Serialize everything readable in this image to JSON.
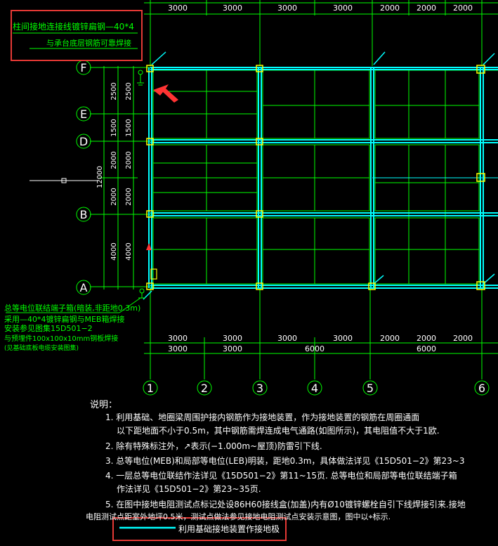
{
  "colors": {
    "background": "#000000",
    "grid": "#00ff00",
    "beam": "#00ffff",
    "column": "#ffff00",
    "text": "#ffffff",
    "highlight": "#e53935"
  },
  "top_dims": [
    "3000",
    "3000",
    "3000",
    "3000",
    "2000",
    "2000",
    "2000"
  ],
  "bottom_dims_row1": [
    "3000",
    "3000",
    "3000",
    "3000",
    "2000",
    "2000",
    "2000"
  ],
  "bottom_dims_row2": [
    "3000",
    "3000",
    "6000",
    "6000"
  ],
  "left_dims_inner": [
    "2500",
    "1500",
    "2000",
    "2000",
    "4000"
  ],
  "left_dims_outer": [
    "2500",
    "1500",
    "2000",
    "2000",
    "4000"
  ],
  "left_total": "12000",
  "row_axes": [
    "F",
    "E",
    "D",
    "B",
    "A"
  ],
  "col_axes": [
    "1",
    "2",
    "3",
    "4",
    "5",
    "6"
  ],
  "callout_top": {
    "line1": "柱间接地连接线镀锌扁钢—40*4",
    "line2": "与承台底层钢筋可靠焊接"
  },
  "callout_bottom": {
    "line1": "总等电位联结端子箱(暗装,非距地0.3m)",
    "line2": "采用—40*4镀锌扁钢与MEB箱焊接",
    "line3": "安装参见图集15D501−2",
    "line4": "与预埋件100x100x10mm钢板焊接",
    "line5": "(见基础底板电缆安装图集)"
  },
  "notes": {
    "title": "说明：",
    "n1a": "1. 利用基础、地圈梁周围护接内钢筋作为接地装置，作为接地装置的钢筋在周圈通面",
    "n1b": "以下距地面不小于0.5m，其中钢筋需焊连成电气通路(如图所示)，其电阻值不大于1欧.",
    "n2": "2. 除有特殊标注外，↗表示(−1.000m~屋顶)防雷引下线.",
    "n3": "3. 总等电位(MEB)和局部等电位(LEB)明装，距地0.3m，具体做法详见《15D501−2》第23~3",
    "n4a": "4. 一层总等电位联结作法详见《15D501−2》第11~15页. 总等电位和局部等电位联结端子箱",
    "n4b": "作法详见《15D501−2》第23~35页.",
    "n5a": "5. 在图中接地电阻测试点标记处设86H60接线盒(加盖)内有Ø10镀锌螺栓自引下线焊接引来.接地",
    "n5b": "电阻测试点距室外地坪0.5米，测试点做法参见接地电阻测试点安装示意图，图中以⌖标示."
  },
  "legend": {
    "label": "利用基础接地装置作接地极"
  }
}
